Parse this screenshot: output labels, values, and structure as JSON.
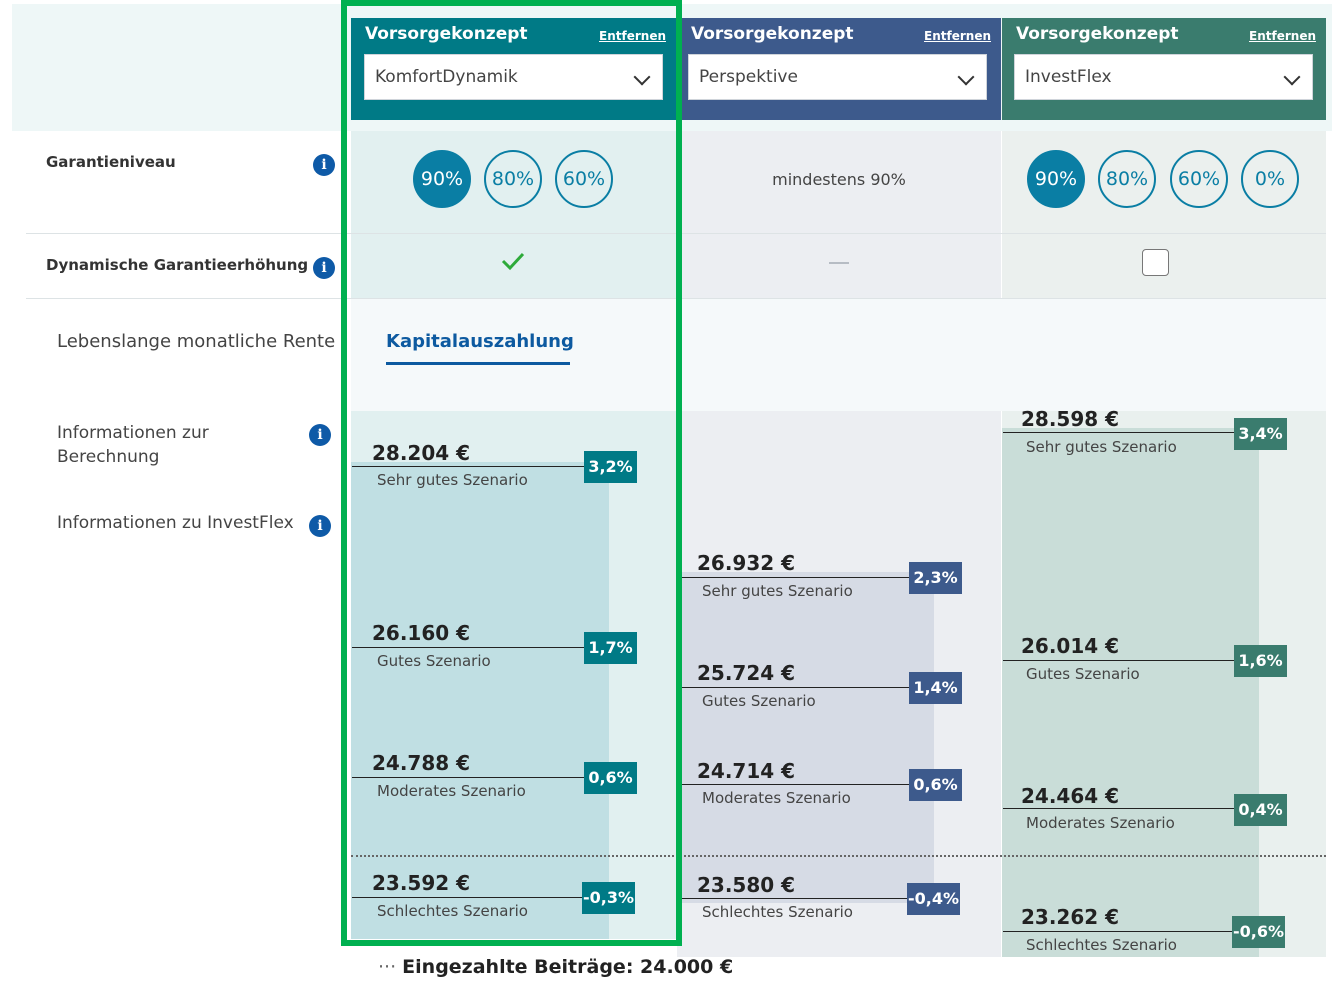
{
  "columns": [
    {
      "title": "Vorsorgekonzept",
      "remove": "Entfernen",
      "product": "KomfortDynamik",
      "head_color": "#007a86"
    },
    {
      "title": "Vorsorgekonzept",
      "remove": "Entfernen",
      "product": "Perspektive",
      "head_color": "#3d5a8c"
    },
    {
      "title": "Vorsorgekonzept",
      "remove": "Entfernen",
      "product": "InvestFlex",
      "head_color": "#3a7c6e"
    }
  ],
  "rows": {
    "garantieniveau": "Garantieniveau",
    "dynamische": "Dynamische Garantieerhöhung"
  },
  "garantie_options": {
    "komfort": [
      "90%",
      "80%",
      "60%"
    ],
    "perspektive_text": "mindestens 90%",
    "investflex": [
      "90%",
      "80%",
      "60%",
      "0%"
    ]
  },
  "dynamische_values": {
    "komfort": "check",
    "perspektive": "dash",
    "investflex": "unchecked"
  },
  "tabs": {
    "rente": "Lebenslange monatliche Rente",
    "kapital": "Kapitalauszahlung"
  },
  "side_links": {
    "info_berechnung_1": "Informationen zur",
    "info_berechnung_2": "Berechnung",
    "info_investflex": "Informationen zu InvestFlex"
  },
  "scenarios": {
    "komfort": [
      {
        "amount": "28.204 €",
        "label": "Sehr gutes Szenario",
        "pct": "3,2%"
      },
      {
        "amount": "26.160 €",
        "label": "Gutes Szenario",
        "pct": "1,7%"
      },
      {
        "amount": "24.788 €",
        "label": "Moderates Szenario",
        "pct": "0,6%"
      },
      {
        "amount": "23.592 €",
        "label": "Schlechtes Szenario",
        "pct": "-0,3%"
      }
    ],
    "perspektive": [
      {
        "amount": "26.932 €",
        "label": "Sehr gutes Szenario",
        "pct": "2,3%"
      },
      {
        "amount": "25.724 €",
        "label": "Gutes Szenario",
        "pct": "1,4%"
      },
      {
        "amount": "24.714 €",
        "label": "Moderates Szenario",
        "pct": "0,6%"
      },
      {
        "amount": "23.580 €",
        "label": "Schlechtes Szenario",
        "pct": "-0,4%"
      }
    ],
    "investflex": [
      {
        "amount": "28.598 €",
        "label": "Sehr gutes Szenario",
        "pct": "3,4%"
      },
      {
        "amount": "26.014 €",
        "label": "Gutes Szenario",
        "pct": "1,6%"
      },
      {
        "amount": "24.464 €",
        "label": "Moderates Szenario",
        "pct": "0,4%"
      },
      {
        "amount": "23.262 €",
        "label": "Schlechtes Szenario",
        "pct": "-0,6%"
      }
    ]
  },
  "footer": {
    "marker": "···",
    "text": "Eingezahlte Beiträge: 24.000 €"
  },
  "colors": {
    "komfort_badge": "#007a86",
    "perspektive_badge": "#3d5a8c",
    "investflex_badge": "#3a7c6e",
    "highlight": "#00b050"
  }
}
